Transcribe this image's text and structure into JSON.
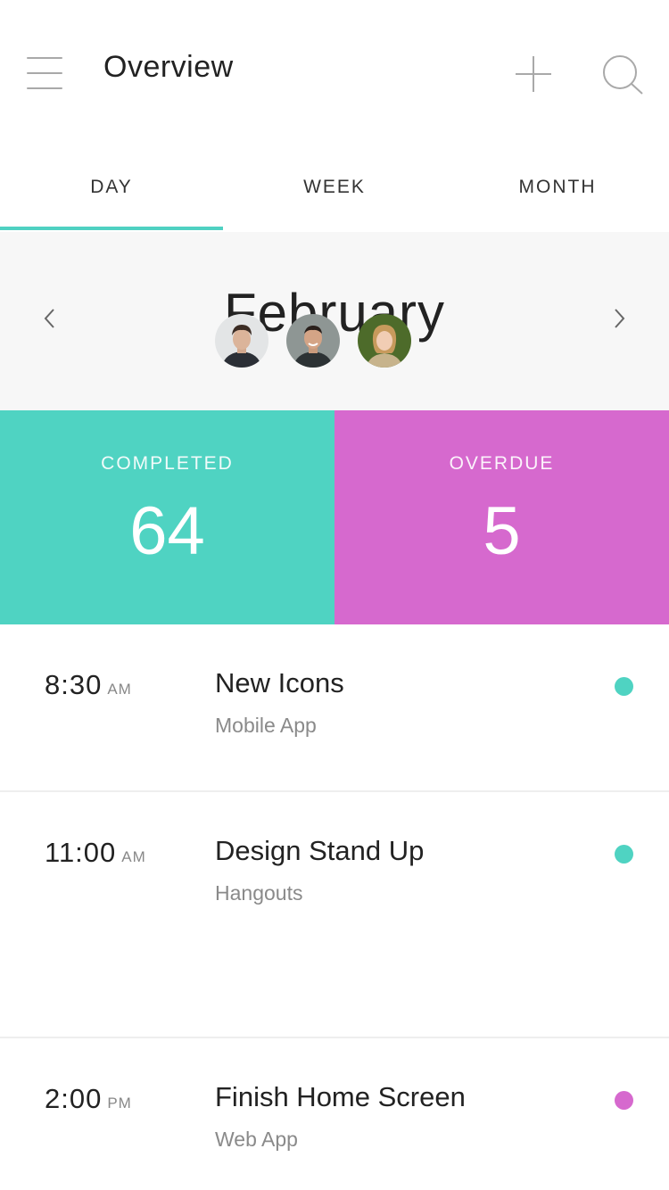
{
  "header": {
    "title": "Overview",
    "menu_icon": "hamburger-menu-icon",
    "add_icon": "plus-icon",
    "search_icon": "search-icon"
  },
  "tabs": [
    {
      "label": "DAY",
      "active": true
    },
    {
      "label": "WEEK",
      "active": false
    },
    {
      "label": "MONTH",
      "active": false
    }
  ],
  "month_selector": {
    "month": "February",
    "prev_icon": "chevron-left-icon",
    "next_icon": "chevron-right-icon"
  },
  "stats": {
    "completed": {
      "label": "COMPLETED",
      "value": "64",
      "color": "#4fd3c2"
    },
    "overdue": {
      "label": "OVERDUE",
      "value": "5",
      "color": "#d669ce"
    }
  },
  "colors": {
    "accent": "#4fd1c2",
    "teal": "#4fd3c2",
    "magenta": "#d669ce"
  },
  "events": [
    {
      "time": "8:30",
      "meridiem": "AM",
      "title": "New Icons",
      "subtitle": "Mobile App",
      "status_color": "#4fd3c2"
    },
    {
      "time": "11:00",
      "meridiem": "AM",
      "title": "Design Stand Up",
      "subtitle": "Hangouts",
      "status_color": "#4fd3c2",
      "attendees": [
        "attendee-avatar-1",
        "attendee-avatar-2",
        "attendee-avatar-3"
      ]
    },
    {
      "time": "2:00",
      "meridiem": "PM",
      "title": "Finish Home Screen",
      "subtitle": "Web App",
      "status_color": "#d669ce"
    }
  ]
}
